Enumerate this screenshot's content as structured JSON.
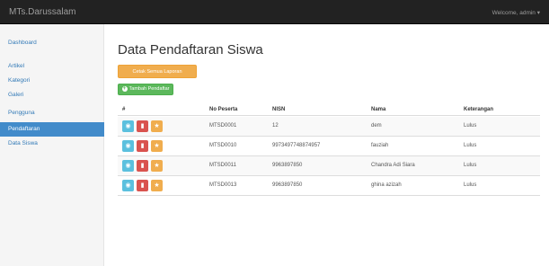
{
  "app": {
    "title": "MTs.Darussalam",
    "welcome": "Welcome, admin ▾"
  },
  "sidebar": {
    "items": [
      {
        "label": "Dashboard",
        "active": false
      },
      {
        "label": "Artikel",
        "active": false
      },
      {
        "label": "Kategori",
        "active": false
      },
      {
        "label": "Galeri",
        "active": false
      },
      {
        "label": "Pengguna",
        "active": false
      },
      {
        "label": "Pendaftaran",
        "active": true
      },
      {
        "label": "Data Siswa",
        "active": false
      }
    ]
  },
  "main": {
    "title": "Data Pendaftaran Siswa",
    "cetak_label": "Cetak Semua Laporan",
    "tambah_label": "Tambah Pendaftar"
  },
  "table": {
    "headers": [
      "#",
      "No Peserta",
      "NISN",
      "Nama",
      "Keterangan"
    ],
    "rows": [
      {
        "no_peserta": "MTSD0001",
        "nisn": "12",
        "nama": "dem",
        "keterangan": "Lulus"
      },
      {
        "no_peserta": "MTSD0010",
        "nisn": "9973497748874957",
        "nama": "fauziah",
        "keterangan": "Lulus"
      },
      {
        "no_peserta": "MTSD0011",
        "nisn": "9963897850",
        "nama": "Chandra Adi Siara",
        "keterangan": "Lulus"
      },
      {
        "no_peserta": "MTSD0013",
        "nisn": "9963897850",
        "nama": "ghina azizah",
        "keterangan": "Lulus"
      }
    ]
  },
  "icons": {
    "view": "eye-icon",
    "delete": "trash-icon",
    "edit": "star-icon",
    "add": "plus-circle-icon"
  },
  "colors": {
    "navbar": "#222222",
    "active": "#428bca",
    "warning": "#f0ad4e",
    "success": "#5cb85c",
    "info": "#5bc0de",
    "danger": "#d9534f"
  }
}
